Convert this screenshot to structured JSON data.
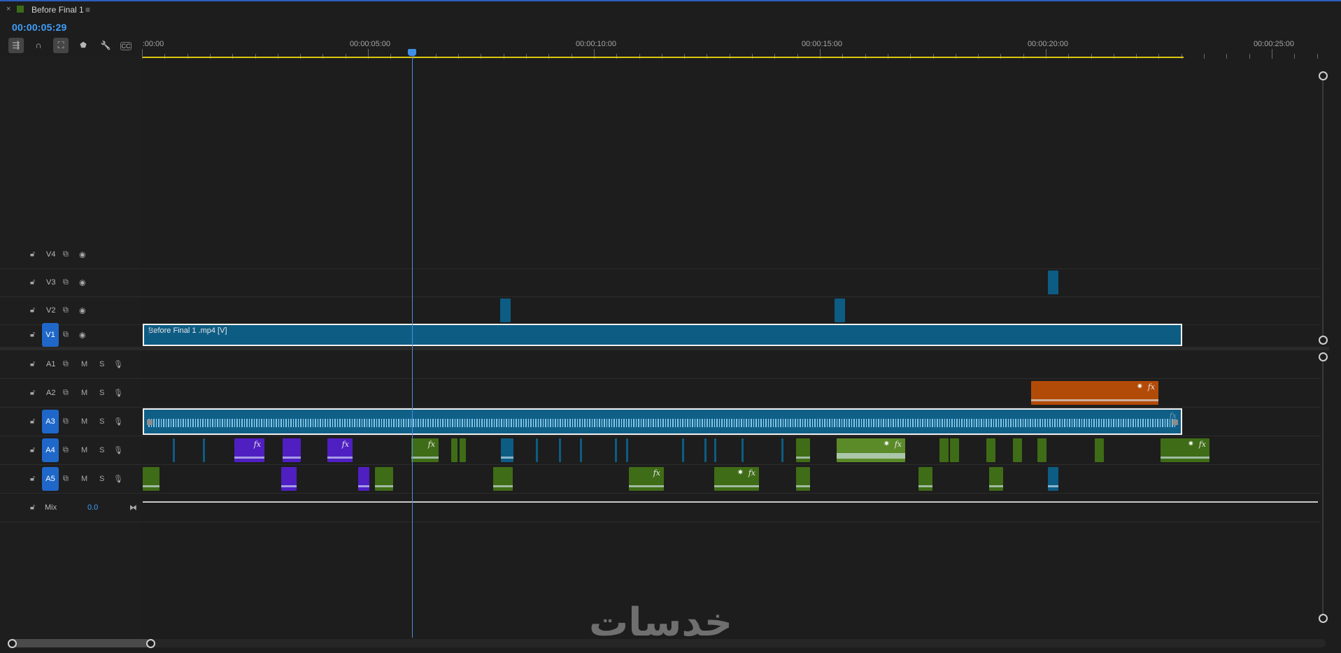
{
  "window": {
    "tab_title": "Before Final 1",
    "close_glyph": "×",
    "menu_glyph": "≡"
  },
  "sequence": {
    "timecode": "00:00:05:29"
  },
  "toolbar": {
    "tools": [
      {
        "name": "insert-overwrite-sequences-icon",
        "glyph": "⇶"
      },
      {
        "name": "snap-icon",
        "glyph": "∩"
      },
      {
        "name": "linked-selection-icon",
        "glyph": "⛶"
      },
      {
        "name": "add-marker-icon",
        "glyph": "⬟"
      },
      {
        "name": "timeline-settings-icon",
        "glyph": "🔧"
      },
      {
        "name": "captions-icon",
        "glyph": "CC"
      }
    ]
  },
  "ruler": {
    "labels": [
      ":00:00",
      "00:00:05:00",
      "00:00:10:00",
      "00:00:15:00",
      "00:00:20:00",
      "00:00:25:00"
    ]
  },
  "video_tracks": [
    {
      "label": "V4",
      "targeted": false
    },
    {
      "label": "V3",
      "targeted": false
    },
    {
      "label": "V2",
      "targeted": false
    },
    {
      "label": "V1",
      "targeted": true
    }
  ],
  "audio_tracks": [
    {
      "label": "A1",
      "targeted": false,
      "mute": "M",
      "solo": "S"
    },
    {
      "label": "A2",
      "targeted": false,
      "mute": "M",
      "solo": "S"
    },
    {
      "label": "A3",
      "targeted": true,
      "mute": "M",
      "solo": "S"
    },
    {
      "label": "A4",
      "targeted": true,
      "mute": "M",
      "solo": "S"
    },
    {
      "label": "A5",
      "targeted": true,
      "mute": "M",
      "solo": "S"
    }
  ],
  "mix": {
    "label": "Mix",
    "value": "0.0"
  },
  "clips": {
    "v1_name": "Before Final 1 .mp4 [V]",
    "fx_glyph": "fx"
  },
  "watermark": {
    "text": "خدسات"
  },
  "colors": {
    "accent": "#3fa0ff",
    "target_track": "#1f67c9",
    "video_clip": "#0d5c84",
    "audio_green": "#3f6c16",
    "audio_purple": "#4f1fc2",
    "audio_orange": "#b24b07",
    "work_area": "#d9c812"
  }
}
